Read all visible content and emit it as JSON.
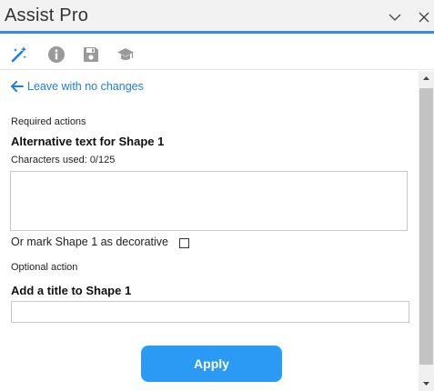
{
  "window": {
    "title": "Assist Pro"
  },
  "toolbar": {
    "tools": [
      {
        "name": "wand-icon",
        "color": "#1e7fd6"
      },
      {
        "name": "info-icon",
        "color": "#9a9a9a"
      },
      {
        "name": "save-icon",
        "color": "#9a9a9a"
      },
      {
        "name": "graduation-cap-icon",
        "color": "#9a9a9a"
      }
    ]
  },
  "content": {
    "back_link": "Leave with no changes",
    "required_label": "Required actions",
    "alt_heading": "Alternative text for Shape 1",
    "chars_used": "Characters used: 0/125",
    "alt_value": "",
    "decorative_label": "Or mark Shape 1 as decorative",
    "decorative_checked": false,
    "optional_label": "Optional action",
    "title_heading": "Add a title to Shape 1",
    "title_value": "",
    "apply_label": "Apply"
  },
  "colors": {
    "accent": "#2f8fe8",
    "link": "#1e7fd6",
    "button": "#2a9af5"
  }
}
